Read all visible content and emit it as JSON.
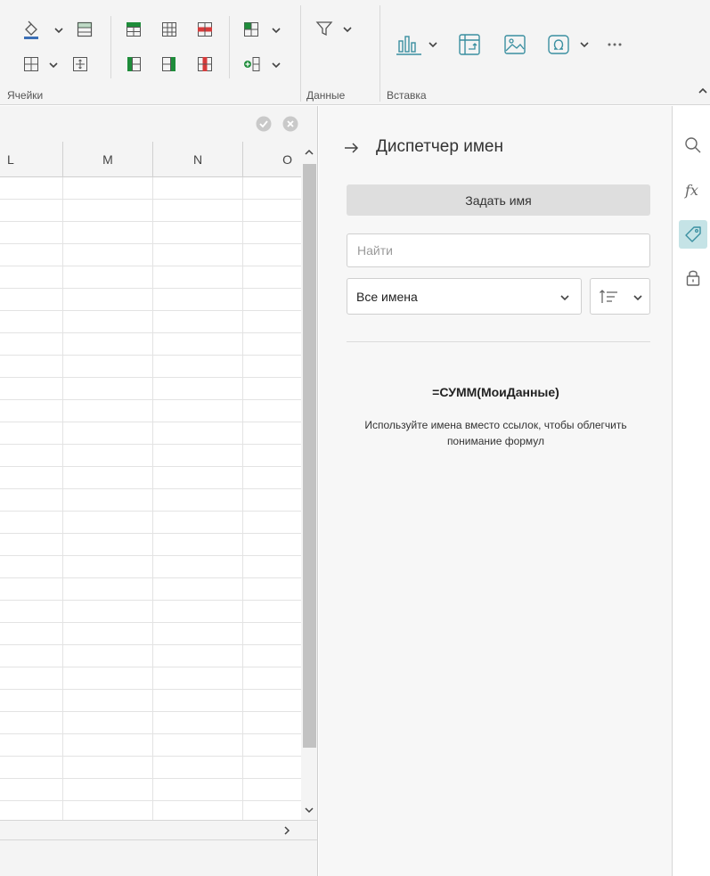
{
  "ribbon": {
    "groups": [
      {
        "label": "Ячейки"
      },
      {
        "label": "Данные"
      },
      {
        "label": "Вставка"
      }
    ],
    "collapse_icon": "chevron-up-icon"
  },
  "sheet": {
    "columns": [
      "L",
      "M",
      "N",
      "O"
    ],
    "confirm_icon": "check-circle-icon",
    "cancel_icon": "close-circle-icon",
    "visible_row_count": 29
  },
  "name_manager": {
    "title": "Диспетчер имен",
    "back_icon": "arrow-right-icon",
    "define_name_label": "Задать имя",
    "search": {
      "placeholder": "Найти",
      "value": ""
    },
    "filter": {
      "selected": "Все имена"
    },
    "sort_icon": "sort-ascending-icon",
    "hint": {
      "formula": "=СУММ(МоиДанные)",
      "text": "Используйте имена вместо ссылок, чтобы облегчить понимание формул"
    }
  },
  "side_rail": {
    "items": [
      {
        "name": "search",
        "icon": "search-icon"
      },
      {
        "name": "functions",
        "icon": "fx-icon"
      },
      {
        "name": "names",
        "icon": "tag-icon",
        "active": true
      },
      {
        "name": "protection",
        "icon": "lock-icon"
      }
    ]
  },
  "colors": {
    "accent": "#3a8fa0",
    "active_rail_bg": "#c5e3e6",
    "green": "#1e8c3a",
    "red": "#d63b3b",
    "blue": "#3b6fb6"
  }
}
